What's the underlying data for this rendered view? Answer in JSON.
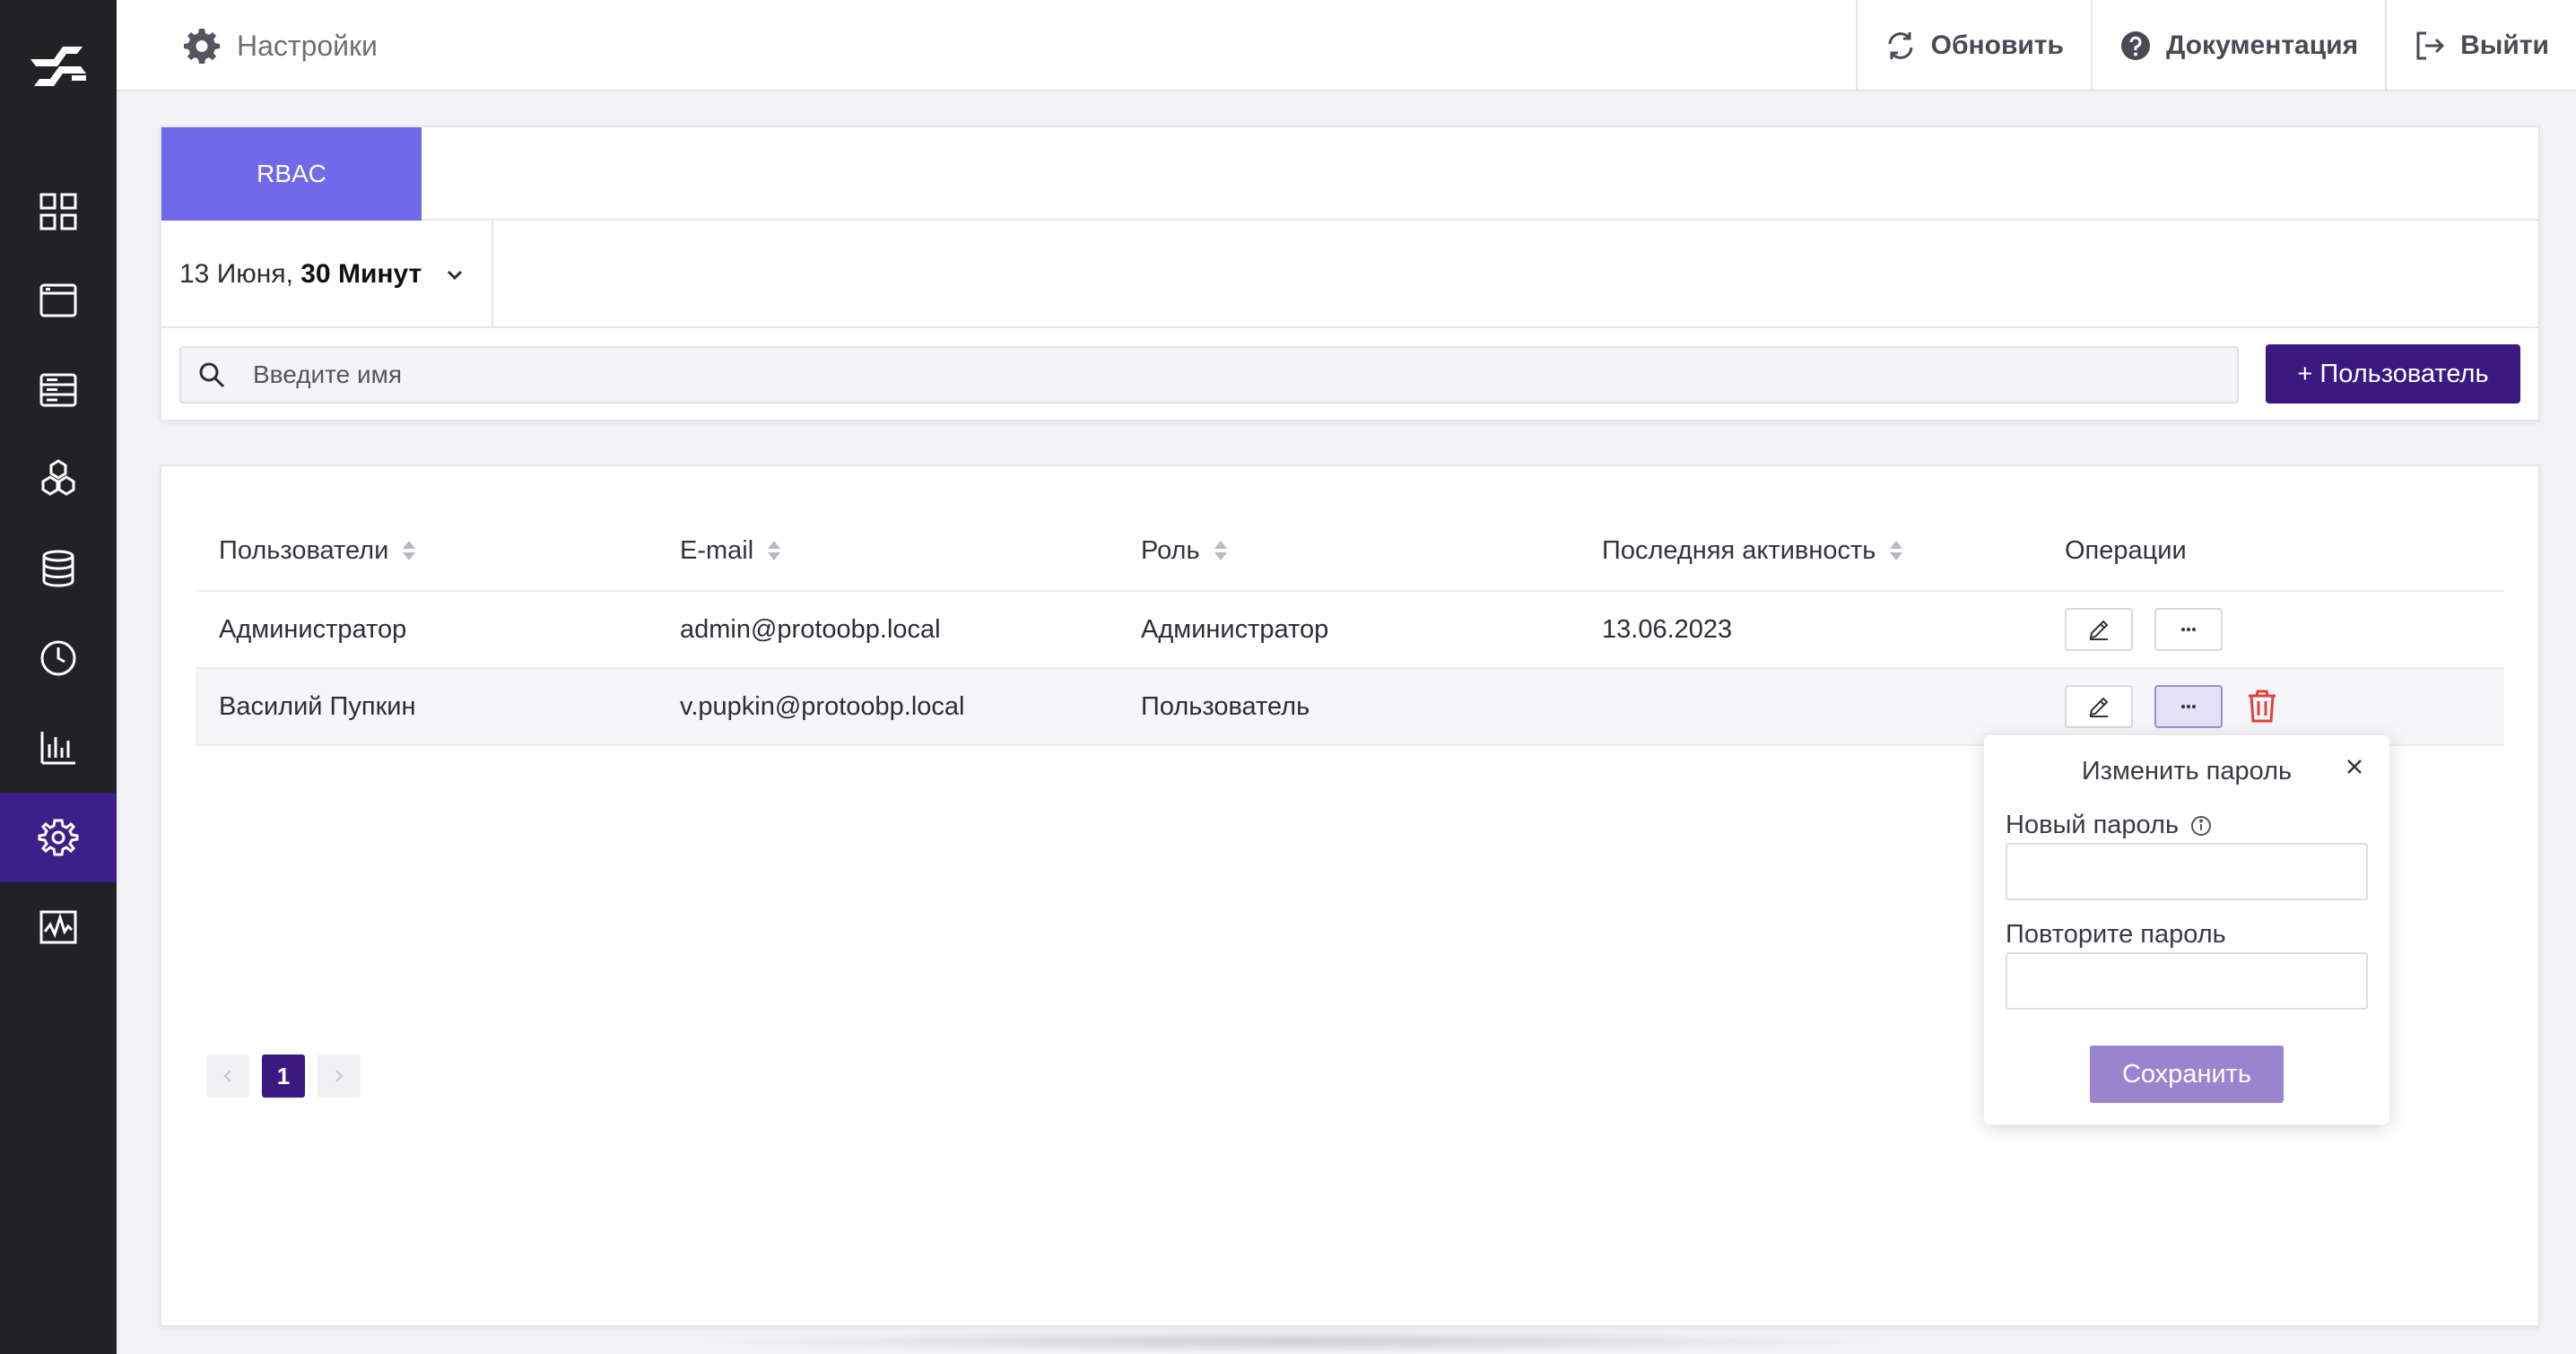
{
  "header": {
    "title": "Настройки",
    "actions": [
      {
        "label": "Обновить",
        "icon": "refresh-icon"
      },
      {
        "label": "Документация",
        "icon": "help-icon"
      },
      {
        "label": "Выйти",
        "icon": "logout-icon"
      }
    ]
  },
  "sidebar": {
    "items": [
      {
        "name": "dashboard-icon",
        "active": false
      },
      {
        "name": "window-icon",
        "active": false
      },
      {
        "name": "server-icon",
        "active": false
      },
      {
        "name": "hexagons-icon",
        "active": false
      },
      {
        "name": "database-icon",
        "active": false
      },
      {
        "name": "clock-icon",
        "active": false
      },
      {
        "name": "bar-chart-icon",
        "active": false
      },
      {
        "name": "gear-icon",
        "active": true
      },
      {
        "name": "activity-icon",
        "active": false
      }
    ]
  },
  "tabs": {
    "rbac": "RBAC"
  },
  "filter": {
    "date_prefix": "13 Июня, ",
    "date_bold": "30 Минут"
  },
  "search": {
    "placeholder": "Введите имя",
    "value": ""
  },
  "add_user_label": "+ Пользователь",
  "table": {
    "columns": [
      "Пользователи",
      "E-mail",
      "Роль",
      "Последняя активность",
      "Операции"
    ],
    "rows": [
      {
        "user": "Администратор",
        "email": "admin@protoobp.local",
        "role": "Администратор",
        "last_active": "13.06.2023"
      },
      {
        "user": "Василий Пупкин",
        "email": "v.pupkin@protoobp.local",
        "role": "Пользователь",
        "last_active": ""
      }
    ]
  },
  "pagination": {
    "current": "1"
  },
  "popover": {
    "title": "Изменить пароль",
    "new_password_label": "Новый пароль",
    "repeat_password_label": "Повторите пароль",
    "save_label": "Сохранить"
  },
  "colors": {
    "sidebar_bg": "#222226",
    "sidebar_active": "#3d1f8a",
    "tab_active": "#7069ea",
    "primary": "#3a1a80",
    "save_button": "#9b84cf",
    "delete": "#e0413a"
  }
}
